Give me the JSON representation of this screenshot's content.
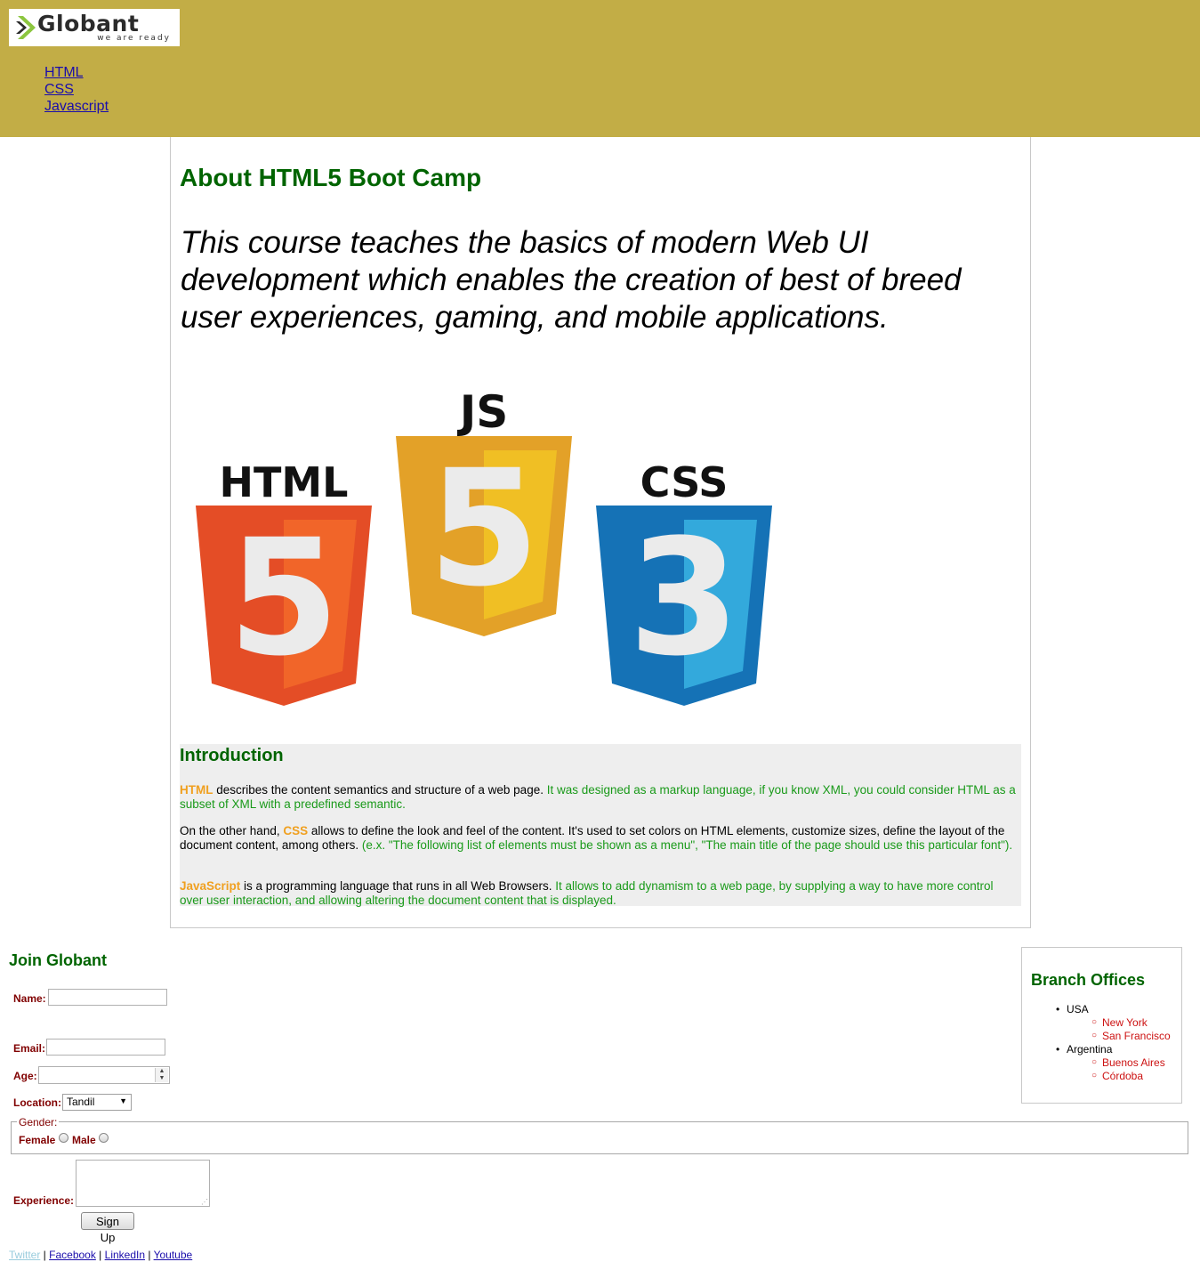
{
  "header": {
    "logo_text": "Globant",
    "logo_tagline": "we are ready",
    "nav": [
      "HTML",
      "CSS",
      "Javascript"
    ]
  },
  "main": {
    "title": "About HTML5 Boot Camp",
    "tagline": "This course teaches the basics of modern Web UI development which enables the creation of best of breed user experiences, gaming, and mobile applications.",
    "logos": [
      {
        "label": "HTML",
        "digit": "5",
        "color_dark": "#e44d26",
        "color_light": "#f16529"
      },
      {
        "label": "JS",
        "digit": "5",
        "color_dark": "#e3a128",
        "color_light": "#f0bf24"
      },
      {
        "label": "CSS",
        "digit": "3",
        "color_dark": "#1572b6",
        "color_light": "#33a9dc"
      }
    ],
    "intro": {
      "title": "Introduction",
      "p1_kw": "HTML",
      "p1_text": " describes the content semantics and structure of a web page. ",
      "p1_green": "It was designed as a markup language, if you know XML, you could consider HTML as a subset of XML with a predefined semantic.",
      "p2_pre": "On the other hand, ",
      "p2_kw": "CSS",
      "p2_text": " allows to define the look and feel of the content. It's used to set colors on HTML elements, customize sizes, define the layout of the document content, among others. ",
      "p2_green": "(e.x. \"The following list of elements must be shown as a menu\", \"The main title of the page should use this particular font\").",
      "p3_kw": "JavaScript",
      "p3_text": " is a programming language that runs in all Web Browsers. ",
      "p3_green": "It allows to add dynamism to a web page, by supplying a way to have more control over user interaction, and allowing altering the document content that is displayed."
    }
  },
  "form": {
    "title": "Join Globant",
    "name_label": "Name:",
    "email_label": "Email:",
    "age_label": "Age:",
    "location_label": "Location:",
    "location_value": "Tandil",
    "gender_legend": "Gender:",
    "female_label": "Female",
    "male_label": "Male",
    "experience_label": "Experience:",
    "submit_label": "Sign Up"
  },
  "branches": {
    "title": "Branch Offices",
    "countries": [
      {
        "name": "USA",
        "cities": [
          "New York",
          "San Francisco"
        ]
      },
      {
        "name": "Argentina",
        "cities": [
          "Buenos Aires",
          "Córdoba"
        ]
      }
    ]
  },
  "footer": {
    "links": [
      "Twitter",
      "Facebook",
      "LinkedIn",
      "Youtube"
    ],
    "separator": " | "
  },
  "colors": {
    "header_bg": "#c2ad46",
    "heading_green": "#006400",
    "keyword_orange": "#f0a020",
    "text_green": "#1a9a1a",
    "label_maroon": "#800000",
    "city_red": "#cc1111"
  }
}
